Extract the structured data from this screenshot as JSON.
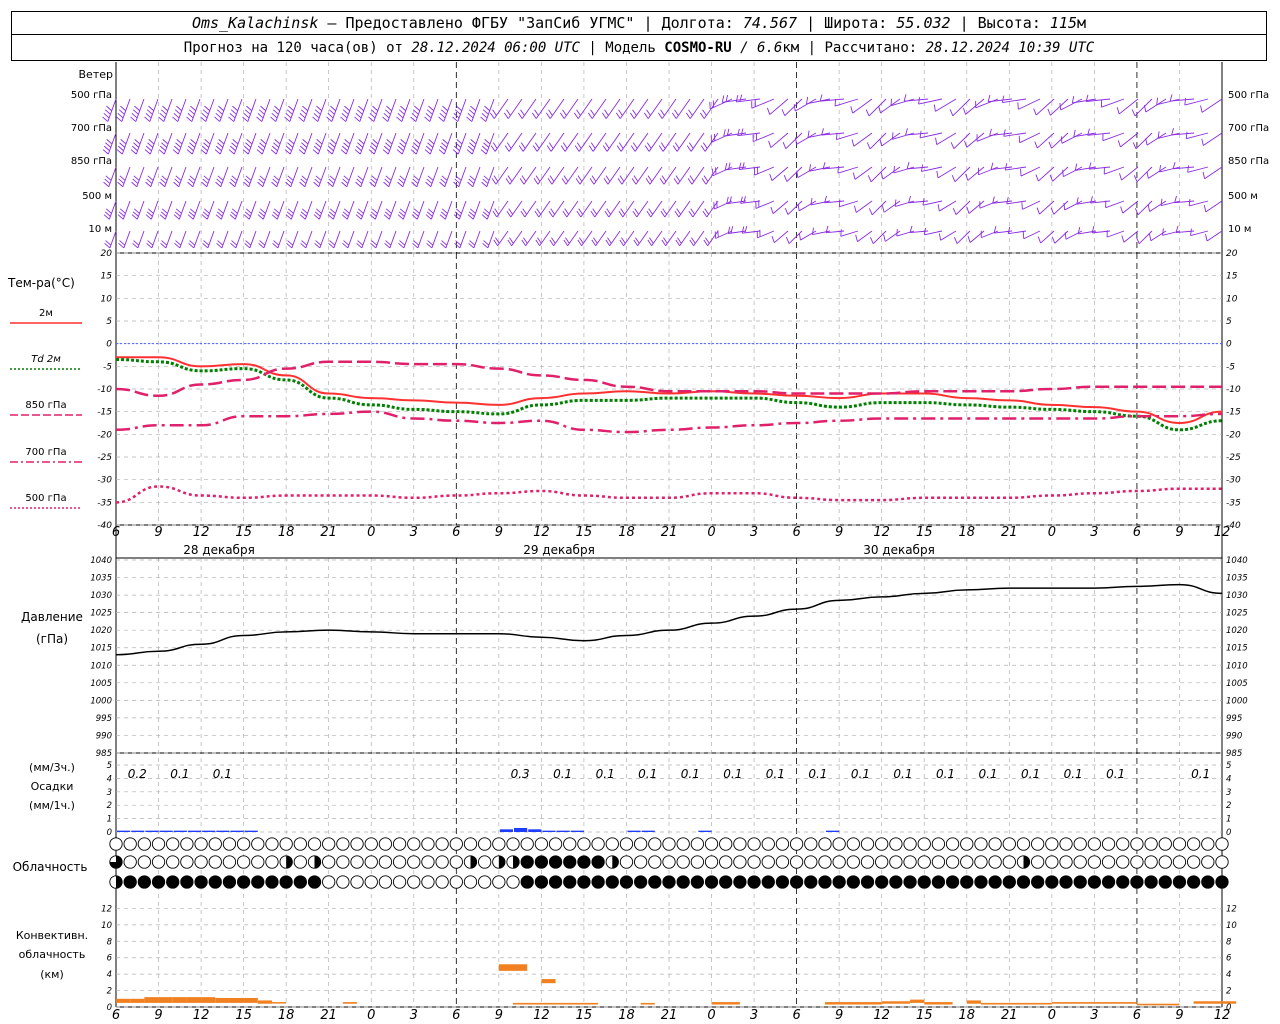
{
  "header": {
    "station": "Oms_Kalachinsk",
    "provided_prefix": "–  Предоставлено ФГБУ \"ЗапСиб УГМС\"",
    "lon_label": "Долгота:",
    "lon_value": "74.567",
    "lat_label": "Широта:",
    "lat_value": "55.032",
    "alt_label": "Высота:",
    "alt_value": "115",
    "alt_unit": "м",
    "forecast_prefix": "Прогноз на 120 часа(ов) от",
    "forecast_start": "28.12.2024 06:00 UTC",
    "model_label": "| Модель",
    "model_name": "COSMO-RU",
    "model_res": "/ 6.6",
    "model_res_unit": "км",
    "calc_label": "| Рассчитано:",
    "calc_time": "28.12.2024 10:39 UTC",
    "sep": "|"
  },
  "wind_panel": {
    "title": "Ветер",
    "levels": [
      "500 гПа",
      "700 гПа",
      "850 гПа",
      "500 м",
      "10  м"
    ]
  },
  "temp_panel": {
    "title": "Тем-ра(°C)",
    "legend": [
      "2м",
      "Td  2м",
      "850 гПа",
      "700 гПа",
      "500 гПа"
    ]
  },
  "pressure_panel": {
    "title1": "Давление",
    "title2": "(гПа)"
  },
  "precip_panel": {
    "unit3": "(мм/3ч.)",
    "title": "Осадки",
    "unit1": "(мм/1ч.)"
  },
  "cloud_panel": {
    "title": "Облачность"
  },
  "conv_panel": {
    "title1": "Конвективн.",
    "title2": "облачность",
    "title3": "(км)"
  },
  "x_ticks": [
    "6",
    "9",
    "12",
    "15",
    "18",
    "21",
    "0",
    "3",
    "6",
    "9",
    "12",
    "15",
    "18",
    "21",
    "0",
    "3",
    "6",
    "9",
    "12",
    "15",
    "18",
    "21",
    "0",
    "3",
    "6",
    "9",
    "12"
  ],
  "day_labels": [
    "28 декабря",
    "29 декабря",
    "30 декабря"
  ],
  "colors": {
    "wind": "#8a2be2",
    "t2m": "#ff3030",
    "td2m": "#008000",
    "t850": "#e0206a",
    "t700": "#e0206a",
    "t500": "#e0206a",
    "zero_line": "#4060ff",
    "pressure": "#000000",
    "precip": "#1e3cff",
    "conv": "#f08020"
  },
  "chart_data": [
    {
      "type": "line",
      "id": "temperature",
      "title": "Тем-ра(°C)",
      "ylim": [
        -40,
        20
      ],
      "y_ticks": [
        20,
        15,
        10,
        5,
        0,
        -5,
        -10,
        -15,
        -20,
        -25,
        -30,
        -35,
        -40
      ],
      "x_hours": [
        0,
        3,
        6,
        9,
        12,
        15,
        18,
        21,
        24,
        27,
        30,
        33,
        36,
        39,
        42,
        45,
        48,
        51,
        54,
        57,
        60,
        63,
        66,
        69,
        72,
        75,
        78
      ],
      "series": [
        {
          "name": "2м",
          "values": [
            -3,
            -3,
            -5,
            -4.5,
            -7,
            -11,
            -12,
            -12.5,
            -13,
            -13.5,
            -12,
            -11,
            -10.5,
            -11,
            -10.5,
            -11,
            -11.5,
            -12,
            -11,
            -11,
            -12,
            -12.5,
            -13.5,
            -14,
            -15,
            -17.5,
            -15
          ]
        },
        {
          "name": "Td  2м",
          "values": [
            -3.5,
            -4,
            -6,
            -5.5,
            -8,
            -12,
            -13.5,
            -14.5,
            -15,
            -15.5,
            -13.5,
            -12.5,
            -12.5,
            -12,
            -12,
            -12,
            -13,
            -14,
            -13,
            -13,
            -13.5,
            -14,
            -14.5,
            -15,
            -16,
            -19,
            -17
          ]
        },
        {
          "name": "850 гПа",
          "values": [
            -10,
            -11.5,
            -9,
            -8,
            -5.5,
            -4,
            -4,
            -4.5,
            -4.5,
            -5.5,
            -7,
            -8,
            -9.5,
            -10.5,
            -10.5,
            -10.5,
            -11,
            -11,
            -11,
            -10.5,
            -10.5,
            -10.5,
            -10,
            -9.5,
            -9.5,
            -9.5,
            -9.5
          ]
        },
        {
          "name": "700 гПа",
          "values": [
            -19,
            -18,
            -18,
            -16,
            -16,
            -15.5,
            -15,
            -16.5,
            -17,
            -17.5,
            -17,
            -19,
            -19.5,
            -19,
            -18.5,
            -18,
            -17.5,
            -17,
            -16.5,
            -16.5,
            -16.5,
            -16.5,
            -16.5,
            -16.5,
            -16,
            -16,
            -15.5
          ]
        },
        {
          "name": "500 гПа",
          "values": [
            -35,
            -31.5,
            -33.5,
            -34,
            -33.5,
            -33.5,
            -33.5,
            -34,
            -33.5,
            -33,
            -32.5,
            -33.5,
            -34,
            -34,
            -33,
            -33,
            -34,
            -34.5,
            -34.5,
            -34,
            -34,
            -34,
            -33.5,
            -33,
            -32.5,
            -32,
            -32
          ]
        }
      ]
    },
    {
      "type": "line",
      "id": "pressure",
      "title": "Давление",
      "ylabel": "(гПа)",
      "ylim": [
        985,
        1040
      ],
      "y_ticks": [
        1040,
        1035,
        1030,
        1025,
        1020,
        1015,
        1010,
        1005,
        1000,
        995,
        990,
        985
      ],
      "x_hours": [
        0,
        3,
        6,
        9,
        12,
        15,
        18,
        21,
        24,
        27,
        30,
        33,
        36,
        39,
        42,
        45,
        48,
        51,
        54,
        57,
        60,
        63,
        66,
        69,
        72,
        75,
        78
      ],
      "series": [
        {
          "name": "",
          "values": [
            1013,
            1014,
            1016,
            1018.5,
            1019.5,
            1020,
            1019.5,
            1019,
            1019,
            1019,
            1018,
            1017,
            1018.5,
            1020,
            1022,
            1024,
            1026,
            1028.5,
            1029.5,
            1030.5,
            1031.5,
            1032,
            1032,
            1032,
            1032.5,
            1033,
            1030.5
          ]
        }
      ]
    },
    {
      "type": "bar",
      "id": "precipitation",
      "title": "Осадки",
      "ylim": [
        0,
        5
      ],
      "y_ticks": [
        5,
        4,
        3,
        2,
        1,
        0
      ],
      "x_hours": [
        1,
        2,
        3,
        4,
        5,
        6,
        7,
        8,
        9,
        10,
        11,
        12,
        13,
        14,
        15,
        16,
        17,
        18,
        19,
        20,
        21,
        22,
        23,
        24,
        25,
        26,
        27,
        28,
        29,
        30,
        31,
        32,
        33,
        34,
        35,
        36,
        37,
        38,
        39,
        40,
        41,
        42,
        43,
        44,
        45,
        46,
        47,
        48,
        49,
        50,
        51,
        52,
        53,
        54,
        55,
        56,
        57,
        58,
        59,
        60,
        61,
        62,
        63,
        64,
        65,
        66,
        67,
        68,
        69,
        70,
        71,
        72,
        73,
        74,
        75,
        76,
        77,
        78
      ],
      "values": [
        0.1,
        0.1,
        0.1,
        0.1,
        0.1,
        0.1,
        0.1,
        0.1,
        0.1,
        0.1,
        0,
        0,
        0,
        0,
        0,
        0,
        0,
        0,
        0,
        0,
        0,
        0,
        0,
        0,
        0,
        0,
        0,
        0.2,
        0.3,
        0.2,
        0.1,
        0.1,
        0.1,
        0,
        0,
        0,
        0.1,
        0.1,
        0,
        0,
        0,
        0.1,
        0,
        0,
        0,
        0,
        0,
        0,
        0,
        0,
        0.1,
        0,
        0,
        0,
        0,
        0,
        0,
        0,
        0,
        0,
        0,
        0,
        0,
        0,
        0,
        0,
        0,
        0,
        0,
        0,
        0,
        0,
        0,
        0,
        0,
        0,
        0,
        0
      ],
      "totals_3h": [
        {
          "hour": 1.5,
          "text": "0.2"
        },
        {
          "hour": 4.5,
          "text": "0.1"
        },
        {
          "hour": 7.5,
          "text": "0.1"
        },
        {
          "hour": 28.5,
          "text": "0.3"
        },
        {
          "hour": 31.5,
          "text": "0.1"
        },
        {
          "hour": 34.5,
          "text": "0.1"
        },
        {
          "hour": 37.5,
          "text": "0.1"
        },
        {
          "hour": 40.5,
          "text": "0.1"
        },
        {
          "hour": 43.5,
          "text": "0.1"
        },
        {
          "hour": 46.5,
          "text": "0.1"
        },
        {
          "hour": 49.5,
          "text": "0.1"
        },
        {
          "hour": 52.5,
          "text": "0.1"
        },
        {
          "hour": 55.5,
          "text": "0.1"
        },
        {
          "hour": 58.5,
          "text": "0.1"
        },
        {
          "hour": 61.5,
          "text": "0.1"
        },
        {
          "hour": 64.5,
          "text": "0.1"
        },
        {
          "hour": 67.5,
          "text": "0.1"
        },
        {
          "hour": 70.5,
          "text": "0.1"
        },
        {
          "hour": 76.5,
          "text": "0.1"
        }
      ]
    },
    {
      "type": "table",
      "id": "cloudiness",
      "title": "Облачность",
      "rows": [
        "upper",
        "middle",
        "lower"
      ],
      "cover_upper": [
        0,
        0,
        0,
        0,
        0,
        0,
        0,
        0,
        0,
        0,
        0,
        0,
        0,
        0,
        0,
        0,
        0,
        0,
        0,
        0,
        0,
        0,
        0,
        0,
        0,
        0,
        0,
        0,
        0,
        0,
        0,
        0,
        0,
        0,
        0,
        0,
        0,
        0,
        0,
        0,
        0,
        0,
        0,
        0,
        0,
        0,
        0,
        0,
        0,
        0,
        0,
        0,
        0,
        0,
        0,
        0,
        0,
        0,
        0,
        0,
        0,
        0,
        0,
        0,
        0,
        0,
        0,
        0,
        0,
        0,
        0,
        0,
        0,
        0,
        0,
        0,
        0,
        0,
        0
      ],
      "cover_middle": [
        0.75,
        0,
        0,
        0,
        0,
        0,
        0,
        0,
        0,
        0,
        0,
        0,
        0.5,
        0,
        0.5,
        0,
        0,
        0,
        0,
        0,
        0,
        0,
        0,
        0,
        0,
        0.5,
        0,
        0.5,
        0.5,
        1,
        1,
        1,
        1,
        1,
        1,
        0.5,
        0,
        0,
        0,
        0,
        0,
        0,
        0,
        0,
        0,
        0,
        0,
        0,
        0,
        0,
        0,
        0,
        0,
        0,
        0,
        0,
        0,
        0,
        0,
        0,
        0,
        0,
        0,
        0,
        0.5,
        0,
        0,
        0,
        0,
        0,
        0,
        0,
        0,
        0,
        0,
        0,
        0,
        0,
        0
      ],
      "cover_lower": [
        0.5,
        1,
        1,
        1,
        1,
        1,
        1,
        1,
        1,
        1,
        1,
        1,
        1,
        1,
        1,
        0,
        0,
        0,
        0,
        0,
        0,
        0,
        0,
        0,
        0,
        0,
        0,
        0,
        0,
        1,
        1,
        1,
        1,
        1,
        1,
        1,
        1,
        1,
        1,
        1,
        1,
        1,
        1,
        1,
        1,
        1,
        1,
        1,
        1,
        1,
        1,
        1,
        1,
        1,
        1,
        1,
        1,
        1,
        1,
        1,
        1,
        1,
        1,
        1,
        1,
        1,
        1,
        1,
        1,
        1,
        1,
        1,
        1,
        1,
        1,
        1,
        1,
        1,
        1
      ]
    },
    {
      "type": "bar",
      "id": "convective_cloud",
      "title": "Конвективн. облачность",
      "ylabel": "(км)",
      "ylim": [
        0,
        14
      ],
      "y_ticks": [
        12,
        10,
        8,
        6,
        4,
        2,
        0
      ],
      "bars": [
        {
          "x0": 0,
          "x1": 1,
          "bottom": 0.5,
          "top": 1
        },
        {
          "x0": 1,
          "x1": 2,
          "bottom": 0.5,
          "top": 1
        },
        {
          "x0": 2,
          "x1": 3,
          "bottom": 0.5,
          "top": 1.2
        },
        {
          "x0": 3,
          "x1": 4,
          "bottom": 0.5,
          "top": 1.2
        },
        {
          "x0": 4,
          "x1": 5,
          "bottom": 0.5,
          "top": 1.2
        },
        {
          "x0": 5,
          "x1": 6,
          "bottom": 0.5,
          "top": 1.2
        },
        {
          "x0": 6,
          "x1": 7,
          "bottom": 0.5,
          "top": 1.2
        },
        {
          "x0": 7,
          "x1": 8,
          "bottom": 0.5,
          "top": 1.1
        },
        {
          "x0": 8,
          "x1": 9,
          "bottom": 0.5,
          "top": 1.1
        },
        {
          "x0": 9,
          "x1": 10,
          "bottom": 0.5,
          "top": 1.1
        },
        {
          "x0": 10,
          "x1": 11,
          "bottom": 0.4,
          "top": 0.8
        },
        {
          "x0": 11,
          "x1": 12,
          "bottom": 0.5,
          "top": 0.6
        },
        {
          "x0": 16,
          "x1": 17,
          "bottom": 0.4,
          "top": 0.6
        },
        {
          "x0": 27,
          "x1": 29,
          "bottom": 4.4,
          "top": 5.2
        },
        {
          "x0": 28,
          "x1": 31,
          "bottom": 0.3,
          "top": 0.5
        },
        {
          "x0": 30,
          "x1": 31,
          "bottom": 2.9,
          "top": 3.4
        },
        {
          "x0": 31,
          "x1": 34,
          "bottom": 0.3,
          "top": 0.5
        },
        {
          "x0": 37,
          "x1": 38,
          "bottom": 0.3,
          "top": 0.5
        },
        {
          "x0": 42,
          "x1": 44,
          "bottom": 0.3,
          "top": 0.6
        },
        {
          "x0": 50,
          "x1": 54,
          "bottom": 0.3,
          "top": 0.6
        },
        {
          "x0": 54,
          "x1": 56,
          "bottom": 0.4,
          "top": 0.7
        },
        {
          "x0": 56,
          "x1": 57,
          "bottom": 0.5,
          "top": 0.9
        },
        {
          "x0": 57,
          "x1": 59,
          "bottom": 0.3,
          "top": 0.6
        },
        {
          "x0": 60,
          "x1": 61,
          "bottom": 0.4,
          "top": 0.8
        },
        {
          "x0": 61,
          "x1": 66,
          "bottom": 0.3,
          "top": 0.5
        },
        {
          "x0": 66,
          "x1": 72,
          "bottom": 0.4,
          "top": 0.6
        },
        {
          "x0": 72,
          "x1": 75,
          "bottom": 0.2,
          "top": 0.4
        },
        {
          "x0": 76,
          "x1": 79,
          "bottom": 0.4,
          "top": 0.7
        }
      ]
    }
  ]
}
